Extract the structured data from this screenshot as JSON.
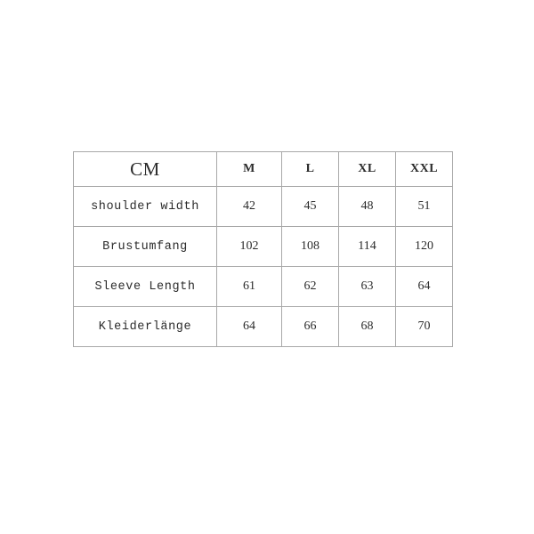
{
  "chart_data": {
    "type": "table",
    "title": "",
    "unit_label": "CM",
    "columns": [
      "CM",
      "M",
      "L",
      "XL",
      "XXL"
    ],
    "size_headers": [
      "M",
      "L",
      "XL",
      "XXL"
    ],
    "rows": [
      {
        "label": "shoulder width",
        "values": [
          "42",
          "45",
          "48",
          "51"
        ]
      },
      {
        "label": "Brustumfang",
        "values": [
          "102",
          "108",
          "114",
          "120"
        ]
      },
      {
        "label": "Sleeve Length",
        "values": [
          "61",
          "62",
          "63",
          "64"
        ]
      },
      {
        "label": "Kleiderlänge",
        "values": [
          "64",
          "66",
          "68",
          "70"
        ]
      }
    ],
    "colors": {
      "background": "#ffffff",
      "border": "#a8a8a8",
      "text": "#2b2b2b",
      "header_text": "#1a1a1a",
      "value_text": "#3a3a3a"
    }
  }
}
